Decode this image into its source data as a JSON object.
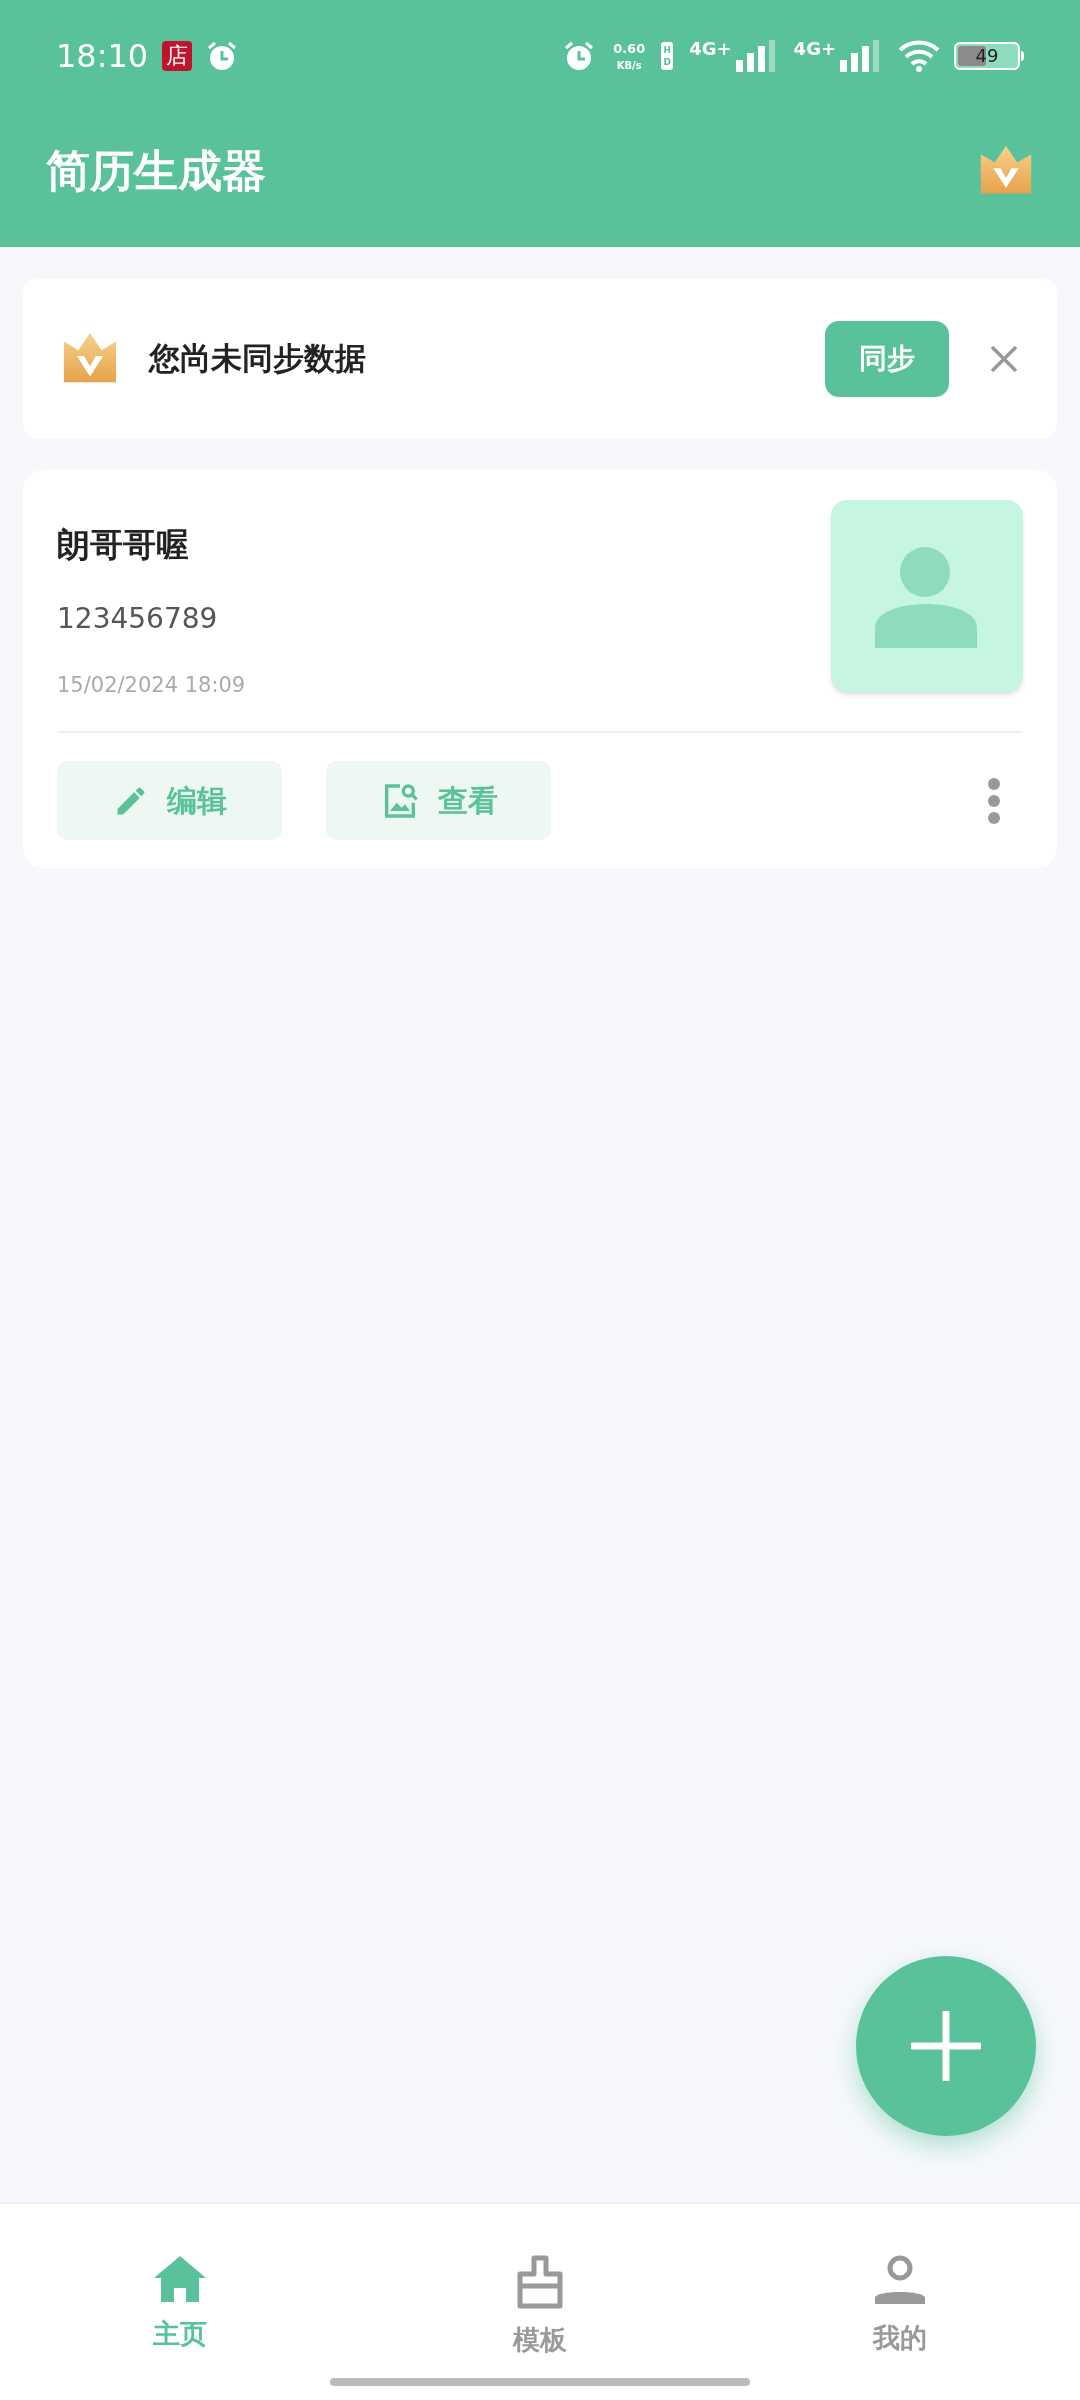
{
  "status_bar": {
    "time": "18:10",
    "app_badge": "店",
    "speed_value": "0.60",
    "speed_unit": "KB/s",
    "hd": "HD",
    "networks": [
      "4G+",
      "4G+"
    ],
    "battery": "49"
  },
  "header": {
    "title": "简历生成器"
  },
  "sync_banner": {
    "message": "您尚未同步数据",
    "button": "同步"
  },
  "resumes": [
    {
      "name": "朗哥哥喔",
      "phone": "123456789",
      "date": "15/02/2024 18:09",
      "actions": [
        {
          "kind": "edit",
          "label": "编辑"
        },
        {
          "kind": "view",
          "label": "查看"
        }
      ]
    }
  ],
  "bottom_nav": [
    {
      "kind": "home",
      "label": "主页",
      "selected": true
    },
    {
      "kind": "templates",
      "label": "模板",
      "selected": false
    },
    {
      "kind": "profile",
      "label": "我的",
      "selected": false
    }
  ]
}
